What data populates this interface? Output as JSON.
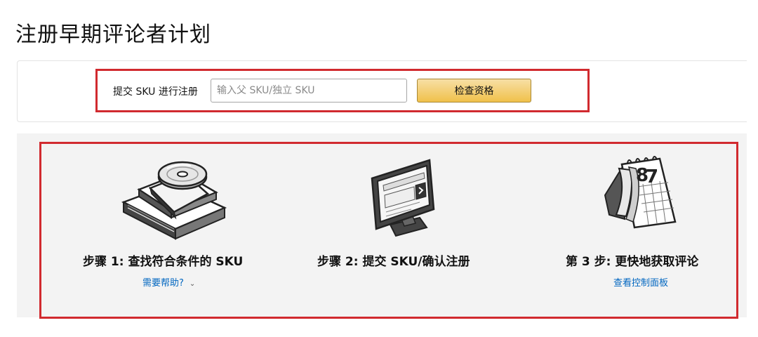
{
  "page": {
    "title": "注册早期评论者计划"
  },
  "register": {
    "label": "提交 SKU 进行注册",
    "input_placeholder": "输入父 SKU/独立 SKU",
    "input_value": "",
    "button_label": "检查资格"
  },
  "steps": [
    {
      "title": "步骤 1:  查找符合条件的 SKU",
      "link": "需要帮助?",
      "icon": "books-disc-icon"
    },
    {
      "title": "步骤 2:  提交 SKU/确认注册",
      "link": "",
      "icon": "monitor-icon"
    },
    {
      "title": "第 3 步:  更快地获取评论",
      "link": "查看控制面板",
      "icon": "calendar-icon"
    }
  ],
  "colors": {
    "highlight_border": "#d12a2f",
    "button_gold": "#f0c14b",
    "link_blue": "#0066c0",
    "steps_background": "#f3f3f3"
  }
}
